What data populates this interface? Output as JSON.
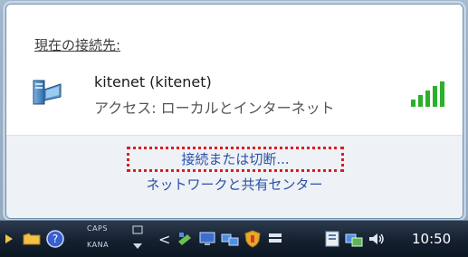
{
  "popup": {
    "section_title": "現在の接続先:",
    "network_name": "kitenet (kitenet)",
    "access_label": "アクセス: ローカルとインターネット",
    "connect_link": "接続または切断...",
    "center_link": "ネットワークと共有センター"
  },
  "taskbar": {
    "caps_label": "CAPS",
    "kana_label": "KANA",
    "clock": "10:50"
  },
  "colors": {
    "link": "#2a52a8",
    "highlight_border": "#dd1c1c",
    "signal": "#2bb02b"
  },
  "icons": {
    "network": "network-computer-icon",
    "signal": "signal-strength-icon"
  }
}
